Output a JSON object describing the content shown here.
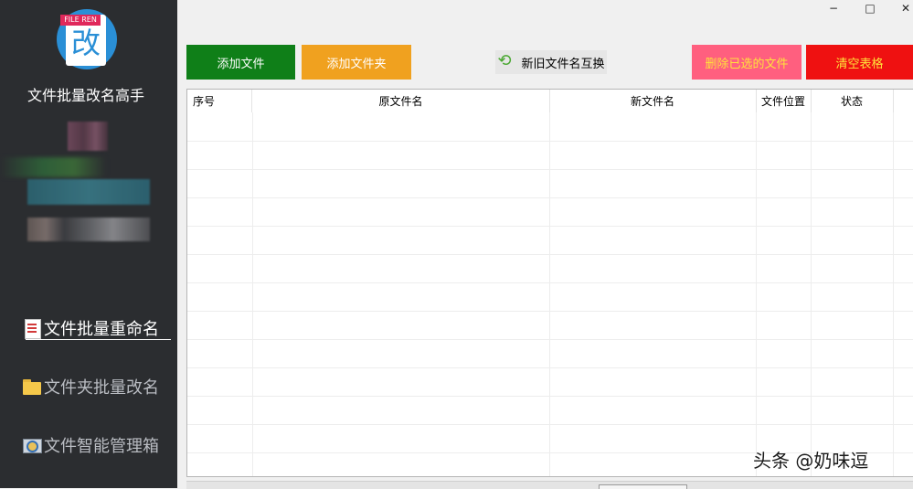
{
  "app": {
    "name": "文件批量改名高手",
    "logo_tag": "FILE REN",
    "logo_glyph": "改"
  },
  "sidebar": {
    "items": [
      {
        "label": "文件批量重命名",
        "icon": "document-icon",
        "active": true
      },
      {
        "label": "文件夹批量改名",
        "icon": "folder-icon",
        "active": false
      },
      {
        "label": "文件智能管理箱",
        "icon": "toolbox-icon",
        "active": false
      }
    ]
  },
  "window": {
    "minimize": "−",
    "maximize": "□",
    "close": "✕"
  },
  "toolbar": {
    "add_file": "添加文件",
    "add_folder": "添加文件夹",
    "swap_names": "新旧文件名互换",
    "delete_selected": "删除已选的文件",
    "clear_table": "清空表格"
  },
  "colors": {
    "add_file": "#0f7f18",
    "add_folder": "#f0a11f",
    "delete_selected": "#ff5f7f",
    "clear_table": "#ef1111",
    "sidebar_bg": "#2b2d30"
  },
  "table": {
    "columns": [
      "序号",
      "原文件名",
      "新文件名",
      "文件位置",
      "状态"
    ],
    "rows": []
  },
  "watermark": "头条 @奶味逗"
}
